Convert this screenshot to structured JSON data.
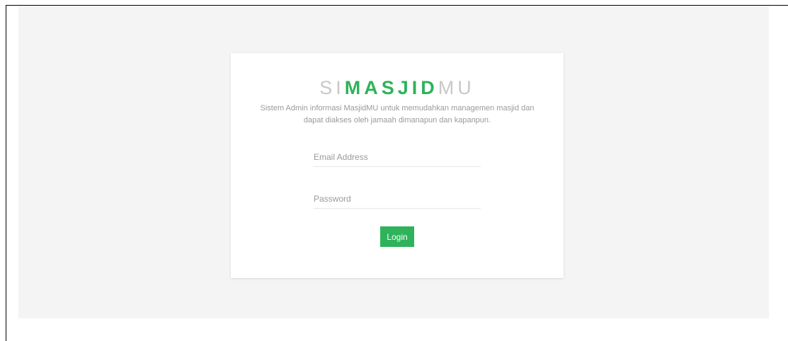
{
  "brand": {
    "prefix": "SI",
    "middle": "MASJID",
    "suffix": "MU"
  },
  "description": "Sistem Admin informasi MasjidMU untuk memudahkan managemen masjid dan dapat diakses oleh jamaah dimanapun dan kapanpun.",
  "form": {
    "email_placeholder": "Email Address",
    "password_placeholder": "Password",
    "login_label": "Login"
  },
  "colors": {
    "accent": "#2eb35a",
    "page_background": "#f4f4f4",
    "card_background": "#ffffff",
    "muted_text": "#9a9a9a"
  }
}
